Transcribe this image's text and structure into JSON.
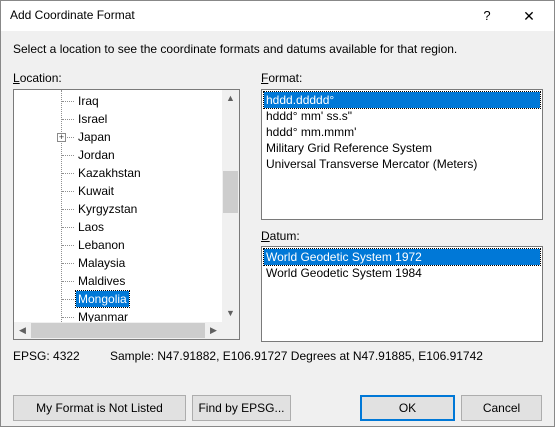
{
  "window": {
    "title": "Add Coordinate Format",
    "help_glyph": "?",
    "close_glyph": "✕"
  },
  "instruction": "Select a location to see the coordinate formats and datums available for that region.",
  "location": {
    "label_mnemonic": "L",
    "label_rest": "ocation:",
    "items": [
      {
        "label": "Iraq",
        "expandable": false,
        "selected": false
      },
      {
        "label": "Israel",
        "expandable": false,
        "selected": false
      },
      {
        "label": "Japan",
        "expandable": true,
        "selected": false
      },
      {
        "label": "Jordan",
        "expandable": false,
        "selected": false
      },
      {
        "label": "Kazakhstan",
        "expandable": false,
        "selected": false
      },
      {
        "label": "Kuwait",
        "expandable": false,
        "selected": false
      },
      {
        "label": "Kyrgyzstan",
        "expandable": false,
        "selected": false
      },
      {
        "label": "Laos",
        "expandable": false,
        "selected": false
      },
      {
        "label": "Lebanon",
        "expandable": false,
        "selected": false
      },
      {
        "label": "Malaysia",
        "expandable": false,
        "selected": false
      },
      {
        "label": "Maldives",
        "expandable": false,
        "selected": false
      },
      {
        "label": "Mongolia",
        "expandable": false,
        "selected": true
      },
      {
        "label": "Myanmar",
        "expandable": false,
        "selected": false
      }
    ],
    "expander_glyph": "+",
    "scroll_up": "▲",
    "scroll_down": "▼",
    "scroll_left": "◀",
    "scroll_right": "▶"
  },
  "format": {
    "label_mnemonic": "F",
    "label_rest": "ormat:",
    "items": [
      {
        "label": "hddd.ddddd°",
        "selected": true
      },
      {
        "label": "hddd° mm' ss.s\"",
        "selected": false
      },
      {
        "label": "hddd° mm.mmm'",
        "selected": false
      },
      {
        "label": "Military Grid Reference System",
        "selected": false
      },
      {
        "label": "Universal Transverse Mercator (Meters)",
        "selected": false
      }
    ]
  },
  "datum": {
    "label_mnemonic": "D",
    "label_rest": "atum:",
    "items": [
      {
        "label": "World Geodetic System 1972",
        "selected": true
      },
      {
        "label": "World Geodetic System 1984",
        "selected": false
      }
    ]
  },
  "epsg_text": "EPSG: 4322",
  "sample_text": "Sample: N47.91882, E106.91727 Degrees at N47.91885, E106.91742",
  "buttons": {
    "not_listed": "My Format is Not Listed",
    "find_epsg": "Find by EPSG...",
    "ok": "OK",
    "cancel": "Cancel"
  },
  "colors": {
    "selection": "#0078d7",
    "dialog_bg": "#f0f0f0"
  }
}
